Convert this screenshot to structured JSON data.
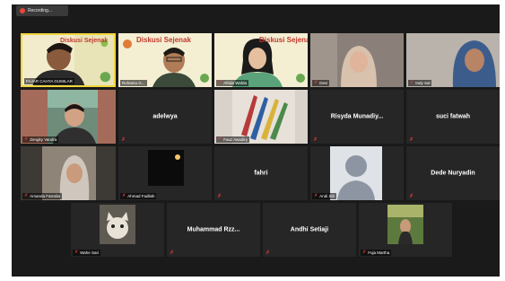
{
  "recording": {
    "label": "Recording..."
  },
  "slide": {
    "title": "Diskusi Sejenak"
  },
  "icons": {
    "mic_muted": "mic-muted-icon",
    "record": "record-dot-icon"
  },
  "colors": {
    "active_speaker": "#f0d63a",
    "mic_muted": "#e83a3a",
    "tile_bg": "#262626",
    "screen_bg": "#1a1a1a"
  },
  "participants": [
    {
      "name": "FAJAR CAHYA GUMILAR",
      "muted": false,
      "speaking": true
    },
    {
      "name": "Rohamu G...",
      "muted": false
    },
    {
      "name": "Afrida Wafda",
      "muted": true
    },
    {
      "name": "Devi",
      "muted": true
    },
    {
      "name": "Indy Sal",
      "muted": true
    },
    {
      "name": "Zengky Vandra",
      "muted": true
    },
    {
      "name": "adelwya",
      "muted": true
    },
    {
      "name": "Fauz Awadiry",
      "muted": true
    },
    {
      "name": "Risyda Munadiy...",
      "muted": true
    },
    {
      "name": "suci fatwah",
      "muted": true
    },
    {
      "name": "Amanda Fatzalia",
      "muted": true
    },
    {
      "name": "Ahmad Fadilah",
      "muted": true
    },
    {
      "name": "fahri",
      "muted": true
    },
    {
      "name": "Andi Siti",
      "muted": true
    },
    {
      "name": "Dede Nuryadin",
      "muted": true
    },
    {
      "name": "Wahe Sari",
      "muted": true
    },
    {
      "name": "Muhammad Rzz...",
      "muted": true
    },
    {
      "name": "Andhi Setiaji",
      "muted": true
    },
    {
      "name": "Fuja Martha",
      "muted": true
    }
  ]
}
